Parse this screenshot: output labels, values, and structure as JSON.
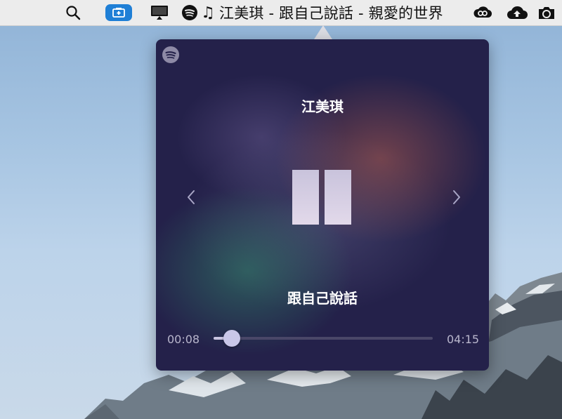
{
  "menubar": {
    "icons": [
      "search-icon",
      "app-window-icon",
      "monitor-icon",
      "spotify-icon",
      "music-note-icon",
      "creative-cloud-icon",
      "cloud-upload-icon",
      "camera-icon"
    ],
    "now_playing_title": "江美琪 - 跟自己說話 - 親愛的世界",
    "accent_color": "#1f7fd6"
  },
  "player": {
    "artist": "江美琪",
    "track": "跟自己說話",
    "time_elapsed": "00:08",
    "time_total": "04:15",
    "progress_fraction": 0.031,
    "state": "playing",
    "icons": [
      "spotify-logo-icon",
      "previous-icon",
      "pause-icon",
      "next-icon"
    ]
  }
}
